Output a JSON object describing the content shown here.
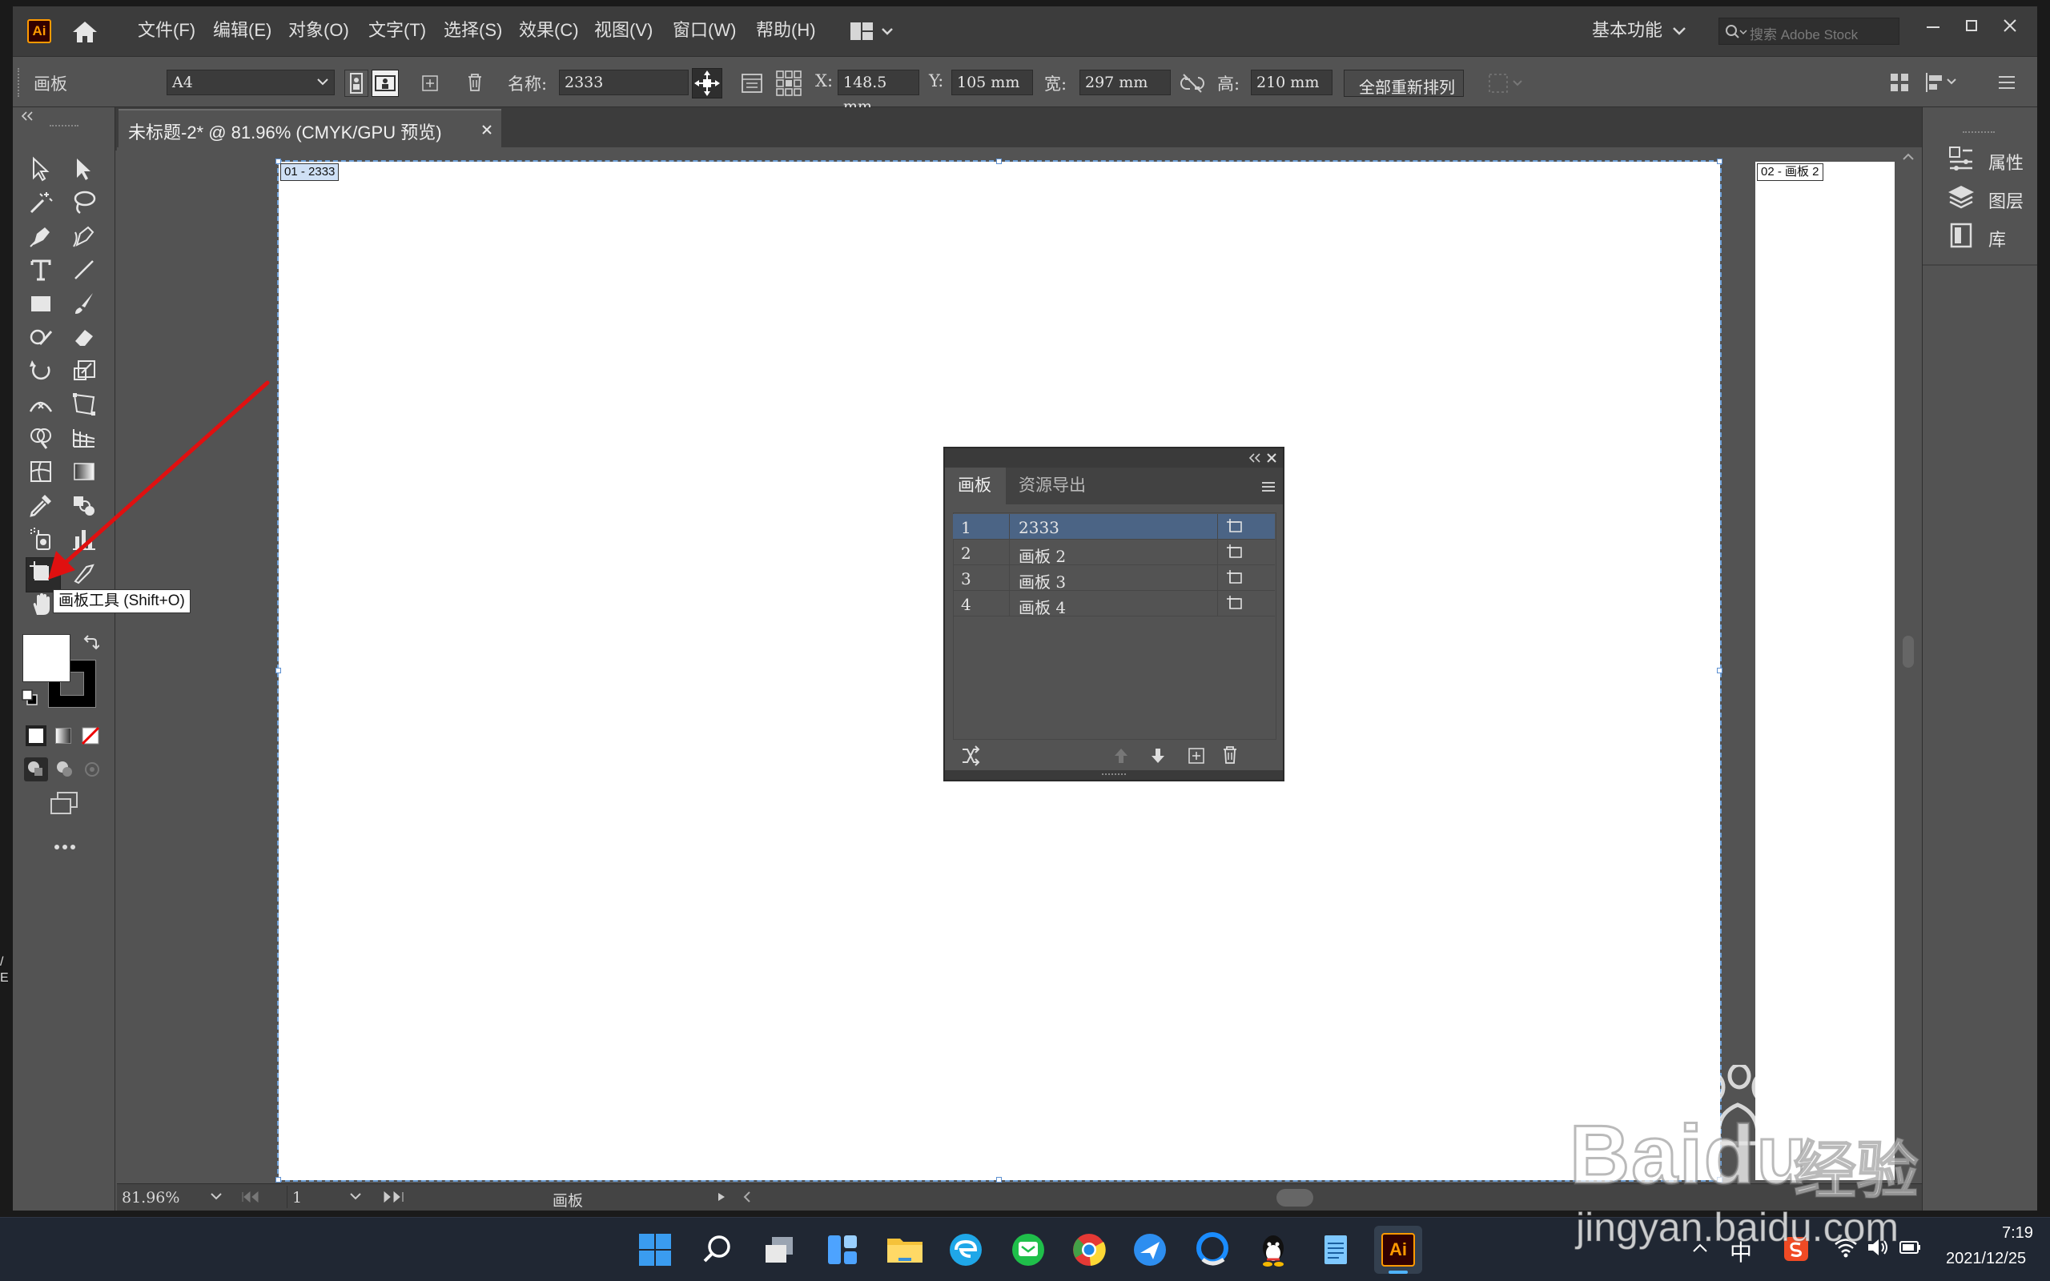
{
  "app": {
    "logo_text": "Ai",
    "menu": [
      "文件(F)",
      "编辑(E)",
      "对象(O)",
      "文字(T)",
      "选择(S)",
      "效果(C)",
      "视图(V)",
      "窗口(W)",
      "帮助(H)"
    ],
    "workspace": "基本功能",
    "search_placeholder": "搜索 Adobe Stock"
  },
  "control_bar": {
    "context_label": "画板",
    "preset_value": "A4",
    "name_label": "名称:",
    "name_value": "2333",
    "x_label": "X:",
    "x_value": "148.5 mm",
    "y_label": "Y:",
    "y_value": "105 mm",
    "w_label": "宽:",
    "w_value": "297 mm",
    "h_label": "高:",
    "h_value": "210 mm",
    "rearrange_label": "全部重新排列"
  },
  "document": {
    "tab_title": "未标题-2* @ 81.96% (CMYK/GPU 预览)",
    "artboard1_label": "01 - 2333",
    "artboard2_label": "02 - 画板 2"
  },
  "tooltip": "画板工具 (Shift+O)",
  "right_panel": {
    "items": [
      "属性",
      "图层",
      "库"
    ]
  },
  "artboards_panel": {
    "tabs": [
      "画板",
      "资源导出"
    ],
    "rows": [
      {
        "num": "1",
        "name": "2333"
      },
      {
        "num": "2",
        "name": "画板 2"
      },
      {
        "num": "3",
        "name": "画板 3"
      },
      {
        "num": "4",
        "name": "画板 4"
      }
    ]
  },
  "status_bar": {
    "zoom": "81.96%",
    "page": "1",
    "mode": "画板"
  },
  "taskbar": {
    "ime": "中",
    "time": "7:19",
    "date": "2021/12/25"
  },
  "watermark": {
    "brand": "Baidu",
    "cn": "经验",
    "url": "jingyan.baidu.com"
  },
  "colors": {
    "ui_dark": "#3c3c3c",
    "ui_mid": "#535353",
    "selection": "#4b6485",
    "arrow_red": "#e01010",
    "ai_orange": "#ff9a00"
  }
}
